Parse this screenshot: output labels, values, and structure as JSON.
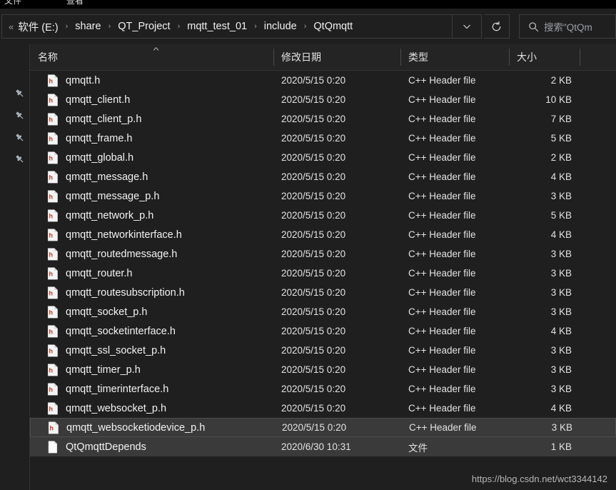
{
  "window": {
    "ribbon_tabs": [
      "文件",
      "查看"
    ]
  },
  "addressbar": {
    "leading_chevrons": "«",
    "separator": "›",
    "crumbs": [
      "软件 (E:)",
      "share",
      "QT_Project",
      "mqtt_test_01",
      "include",
      "QtQmqtt"
    ],
    "dropdown_icon": "chevron-down-icon",
    "refresh_icon": "refresh-icon"
  },
  "search": {
    "icon": "search-icon",
    "placeholder": "搜索\"QtQm"
  },
  "navpane": {
    "pins": [
      "pin-icon",
      "pin-icon",
      "pin-icon",
      "pin-icon"
    ]
  },
  "columns": {
    "name": "名称",
    "date": "修改日期",
    "type": "类型",
    "size": "大小",
    "sort_indicator": "^"
  },
  "files": [
    {
      "name": "qmqtt.h",
      "date": "2020/5/15 0:20",
      "type": "C++ Header file",
      "size": "2 KB",
      "icon": "h-header-file-icon",
      "selected": false,
      "focused": false
    },
    {
      "name": "qmqtt_client.h",
      "date": "2020/5/15 0:20",
      "type": "C++ Header file",
      "size": "10 KB",
      "icon": "h-header-file-icon",
      "selected": false,
      "focused": false
    },
    {
      "name": "qmqtt_client_p.h",
      "date": "2020/5/15 0:20",
      "type": "C++ Header file",
      "size": "7 KB",
      "icon": "h-header-file-icon",
      "selected": false,
      "focused": false
    },
    {
      "name": "qmqtt_frame.h",
      "date": "2020/5/15 0:20",
      "type": "C++ Header file",
      "size": "5 KB",
      "icon": "h-header-file-icon",
      "selected": false,
      "focused": false
    },
    {
      "name": "qmqtt_global.h",
      "date": "2020/5/15 0:20",
      "type": "C++ Header file",
      "size": "2 KB",
      "icon": "h-header-file-icon",
      "selected": false,
      "focused": false
    },
    {
      "name": "qmqtt_message.h",
      "date": "2020/5/15 0:20",
      "type": "C++ Header file",
      "size": "4 KB",
      "icon": "h-header-file-icon",
      "selected": false,
      "focused": false
    },
    {
      "name": "qmqtt_message_p.h",
      "date": "2020/5/15 0:20",
      "type": "C++ Header file",
      "size": "3 KB",
      "icon": "h-header-file-icon",
      "selected": false,
      "focused": false
    },
    {
      "name": "qmqtt_network_p.h",
      "date": "2020/5/15 0:20",
      "type": "C++ Header file",
      "size": "5 KB",
      "icon": "h-header-file-icon",
      "selected": false,
      "focused": false
    },
    {
      "name": "qmqtt_networkinterface.h",
      "date": "2020/5/15 0:20",
      "type": "C++ Header file",
      "size": "4 KB",
      "icon": "h-header-file-icon",
      "selected": false,
      "focused": false
    },
    {
      "name": "qmqtt_routedmessage.h",
      "date": "2020/5/15 0:20",
      "type": "C++ Header file",
      "size": "3 KB",
      "icon": "h-header-file-icon",
      "selected": false,
      "focused": false
    },
    {
      "name": "qmqtt_router.h",
      "date": "2020/5/15 0:20",
      "type": "C++ Header file",
      "size": "3 KB",
      "icon": "h-header-file-icon",
      "selected": false,
      "focused": false
    },
    {
      "name": "qmqtt_routesubscription.h",
      "date": "2020/5/15 0:20",
      "type": "C++ Header file",
      "size": "3 KB",
      "icon": "h-header-file-icon",
      "selected": false,
      "focused": false
    },
    {
      "name": "qmqtt_socket_p.h",
      "date": "2020/5/15 0:20",
      "type": "C++ Header file",
      "size": "3 KB",
      "icon": "h-header-file-icon",
      "selected": false,
      "focused": false
    },
    {
      "name": "qmqtt_socketinterface.h",
      "date": "2020/5/15 0:20",
      "type": "C++ Header file",
      "size": "4 KB",
      "icon": "h-header-file-icon",
      "selected": false,
      "focused": false
    },
    {
      "name": "qmqtt_ssl_socket_p.h",
      "date": "2020/5/15 0:20",
      "type": "C++ Header file",
      "size": "3 KB",
      "icon": "h-header-file-icon",
      "selected": false,
      "focused": false
    },
    {
      "name": "qmqtt_timer_p.h",
      "date": "2020/5/15 0:20",
      "type": "C++ Header file",
      "size": "3 KB",
      "icon": "h-header-file-icon",
      "selected": false,
      "focused": false
    },
    {
      "name": "qmqtt_timerinterface.h",
      "date": "2020/5/15 0:20",
      "type": "C++ Header file",
      "size": "3 KB",
      "icon": "h-header-file-icon",
      "selected": false,
      "focused": false
    },
    {
      "name": "qmqtt_websocket_p.h",
      "date": "2020/5/15 0:20",
      "type": "C++ Header file",
      "size": "4 KB",
      "icon": "h-header-file-icon",
      "selected": false,
      "focused": false
    },
    {
      "name": "qmqtt_websocketiodevice_p.h",
      "date": "2020/5/15 0:20",
      "type": "C++ Header file",
      "size": "3 KB",
      "icon": "h-header-file-icon",
      "selected": true,
      "focused": true
    },
    {
      "name": "QtQmqttDepends",
      "date": "2020/6/30 10:31",
      "type": "文件",
      "size": "1 KB",
      "icon": "blank-file-icon",
      "selected": true,
      "focused": false
    }
  ],
  "watermark": "https://blog.csdn.net/wct3344142",
  "colors": {
    "background": "#1f1f1f",
    "header_background": "#242424",
    "selection": "#3a3a3a",
    "text": "#f2f2f2",
    "muted_text": "#9aa0a6",
    "icon_accent": "#c0392b",
    "divider": "#4a4a4a"
  }
}
